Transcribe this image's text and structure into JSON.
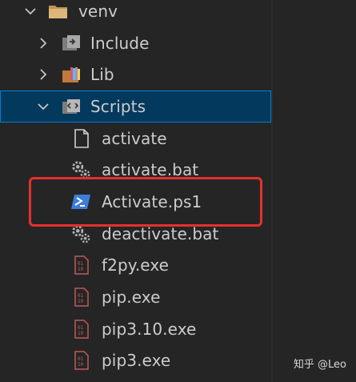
{
  "explorer": {
    "items": [
      {
        "label": "venv",
        "kind": "folder-open",
        "expanded": true,
        "icon": "folder-icon"
      },
      {
        "label": "Include",
        "kind": "folder",
        "expanded": false,
        "icon": "include-folder-icon"
      },
      {
        "label": "Lib",
        "kind": "folder",
        "expanded": false,
        "icon": "lib-folder-icon"
      },
      {
        "label": "Scripts",
        "kind": "folder",
        "expanded": true,
        "selected": true,
        "icon": "scripts-folder-icon"
      },
      {
        "label": "activate",
        "kind": "file",
        "icon": "file-icon"
      },
      {
        "label": "activate.bat",
        "kind": "file",
        "icon": "gear-icon"
      },
      {
        "label": "Activate.ps1",
        "kind": "file",
        "icon": "powershell-icon",
        "highlighted": true
      },
      {
        "label": "deactivate.bat",
        "kind": "file",
        "icon": "gear-icon"
      },
      {
        "label": "f2py.exe",
        "kind": "file",
        "icon": "binary-icon"
      },
      {
        "label": "pip.exe",
        "kind": "file",
        "icon": "binary-icon"
      },
      {
        "label": "pip3.10.exe",
        "kind": "file",
        "icon": "binary-icon"
      },
      {
        "label": "pip3.exe",
        "kind": "file",
        "icon": "binary-icon"
      }
    ]
  },
  "watermark": "知乎 @Leo",
  "colors": {
    "background": "#252526",
    "selection_bg": "#04395e",
    "selection_border": "#007fd4",
    "highlight_box": "#e5302c",
    "text": "#cccccc"
  }
}
